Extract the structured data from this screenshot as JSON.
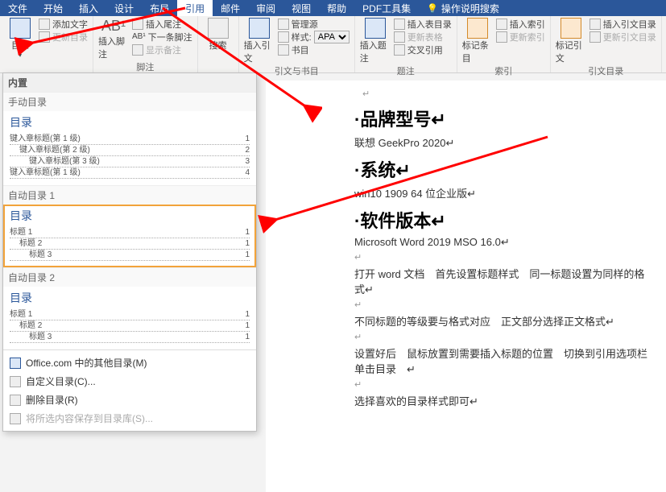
{
  "menu": {
    "items": [
      "文件",
      "开始",
      "插入",
      "设计",
      "布局",
      "引用",
      "邮件",
      "审阅",
      "视图",
      "帮助",
      "PDF工具集"
    ],
    "active": "引用",
    "tell_me": "操作说明搜索"
  },
  "ribbon": {
    "g1": {
      "btn_big": "目录",
      "add_text": "添加文字",
      "update": "更新目录",
      "label": ""
    },
    "g2": {
      "btn_big": "插入脚注",
      "insert_end": "插入尾注",
      "next": "下一条脚注",
      "show": "显示备注",
      "label": "脚注"
    },
    "g3": {
      "btn_big": "搜索",
      "label": ""
    },
    "g4": {
      "btn_big": "插入引文",
      "manage": "管理源",
      "style_label": "样式:",
      "style_value": "APA",
      "biblio": "书目",
      "label": "引文与书目"
    },
    "g5": {
      "btn_big": "插入题注",
      "fig_toc": "插入表目录",
      "update_tbl": "更新表格",
      "cross": "交叉引用",
      "label": "题注"
    },
    "g6": {
      "btn_big": "标记条目",
      "insert_idx": "插入索引",
      "update_idx": "更新索引",
      "label": "索引"
    },
    "g7": {
      "btn_big": "标记引文",
      "insert_cit": "插入引文目录",
      "update_cit": "更新引文目录",
      "label": "引文目录"
    }
  },
  "dropdown": {
    "header": "内置",
    "manual": {
      "label": "手动目录",
      "title": "目录",
      "line1_l": "键入章标题(第 1 级)",
      "line1_r": "1",
      "line2_l": "键入章标题(第 2 级)",
      "line2_r": "2",
      "line3_l": "键入章标题(第 3 级)",
      "line3_r": "3",
      "line4_l": "键入章标题(第 1 级)",
      "line4_r": "4"
    },
    "auto1": {
      "label": "自动目录 1",
      "title": "目录",
      "line1_l": "标题 1",
      "line1_r": "1",
      "line2_l": "标题 2",
      "line2_r": "1",
      "line3_l": "标题 3",
      "line3_r": "1"
    },
    "auto2": {
      "label": "自动目录 2",
      "title": "目录",
      "line1_l": "标题 1",
      "line1_r": "1",
      "line2_l": "标题 2",
      "line2_r": "1",
      "line3_l": "标题 3",
      "line3_r": "1"
    },
    "footer": {
      "more": "Office.com 中的其他目录(M)",
      "custom": "自定义目录(C)...",
      "remove": "删除目录(R)",
      "save": "将所选内容保存到目录库(S)..."
    }
  },
  "doc": {
    "cursor": "↵",
    "h1": "·品牌型号↵",
    "p1": "联想 GeekPro 2020↵",
    "h2": "·系统↵",
    "p2": "win10 1909 64 位企业版↵",
    "h3": "·软件版本↵",
    "p3": "Microsoft Word 2019 MSO 16.0↵",
    "p4a": "打开 word 文档　首先设置标题样式　同一标题设置为同样的格式↵",
    "p4b": "不同标题的等级要与格式对应　正文部分选择正文格式↵",
    "p4c": "设置好后　鼠标放置到需要插入标题的位置　切换到引用选项栏　单击目录　↵",
    "p4d": "选择喜欢的目录样式即可↵"
  }
}
